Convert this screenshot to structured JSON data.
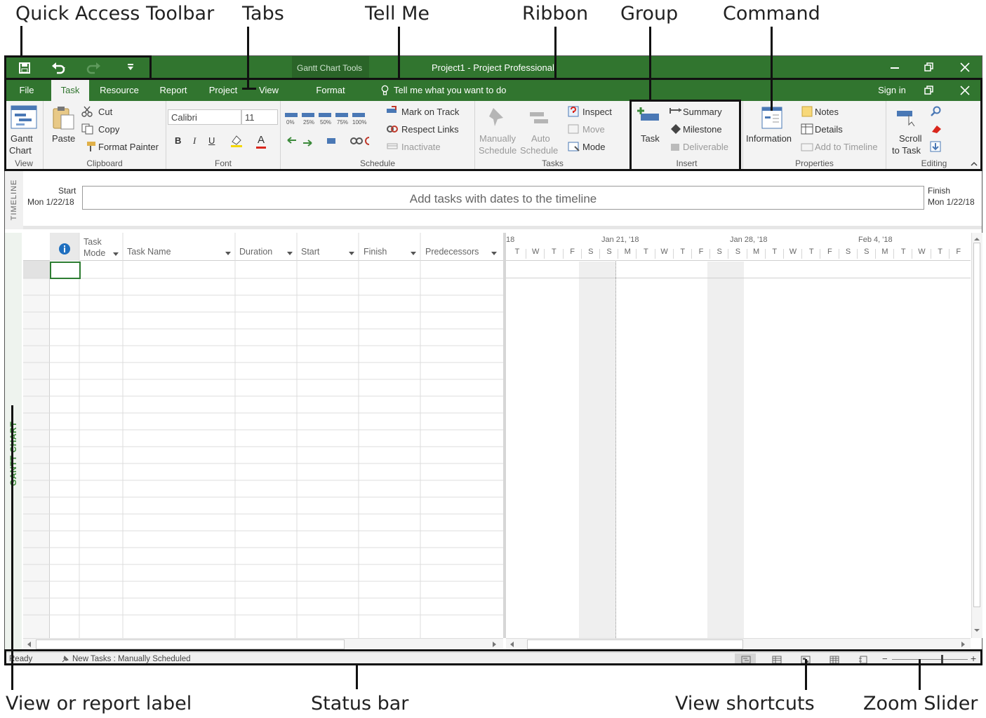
{
  "callouts": {
    "quick_access_toolbar": "Quick Access Toolbar",
    "tabs": "Tabs",
    "tell_me": "Tell Me",
    "ribbon": "Ribbon",
    "group": "Group",
    "command": "Command",
    "view_label": "View or report label",
    "status_bar": "Status bar",
    "view_shortcuts": "View shortcuts",
    "zoom_slider": "Zoom Slider"
  },
  "titlebar": {
    "context_tools": "Gantt Chart Tools",
    "window_title": "Project1 - Project Professional"
  },
  "tabs": [
    "File",
    "Task",
    "Resource",
    "Report",
    "Project",
    "View"
  ],
  "context_tab": "Format",
  "tell_me": "Tell me what you want to do",
  "sign_in": "Sign in",
  "ribbon": {
    "view": {
      "btn_line1": "Gantt",
      "btn_line2": "Chart",
      "label": "View"
    },
    "clipboard": {
      "paste": "Paste",
      "cut": "Cut",
      "copy": "Copy",
      "format_painter": "Format Painter",
      "label": "Clipboard"
    },
    "font": {
      "font_name": "Calibri",
      "font_size": "11",
      "bold": "B",
      "italic": "I",
      "underline": "U",
      "color": "A",
      "label": "Font"
    },
    "schedule": {
      "pcts": [
        "0%",
        "25%",
        "50%",
        "75%",
        "100%"
      ],
      "mark_on_track": "Mark on Track",
      "respect_links": "Respect Links",
      "inactivate": "Inactivate",
      "label": "Schedule"
    },
    "tasks": {
      "manually_1": "Manually",
      "manually_2": "Schedule",
      "auto_1": "Auto",
      "auto_2": "Schedule",
      "inspect": "Inspect",
      "move": "Move",
      "mode": "Mode",
      "label": "Tasks"
    },
    "insert": {
      "task": "Task",
      "summary": "Summary",
      "milestone": "Milestone",
      "deliverable": "Deliverable",
      "label": "Insert"
    },
    "properties": {
      "information": "Information",
      "notes": "Notes",
      "details": "Details",
      "add_to_timeline": "Add to Timeline",
      "label": "Properties"
    },
    "editing": {
      "scroll_1": "Scroll",
      "scroll_2": "to Task",
      "label": "Editing"
    }
  },
  "timeline": {
    "side_label": "TIMELINE",
    "start_label": "Start",
    "start_date": "Mon 1/22/18",
    "placeholder": "Add tasks with dates to the timeline",
    "finish_label": "Finish",
    "finish_date": "Mon 1/22/18"
  },
  "grid": {
    "side_label": "GANTT CHART",
    "columns": [
      "Task Mode",
      "Task Name",
      "Duration",
      "Start",
      "Finish",
      "Predecessors"
    ],
    "task_mode_1": "Task",
    "task_mode_2": "Mode",
    "info_icon": "i"
  },
  "gantt": {
    "weeks": [
      "18",
      "Jan 21, '18",
      "Jan 28, '18",
      "Feb 4, '18"
    ],
    "days": [
      "T",
      "W",
      "T",
      "F",
      "S",
      "S",
      "M",
      "T",
      "W",
      "T",
      "F",
      "S",
      "S",
      "M",
      "T",
      "W",
      "T",
      "F",
      "S",
      "S",
      "M",
      "T",
      "W",
      "T",
      "F"
    ]
  },
  "status": {
    "ready": "Ready",
    "new_tasks": "New Tasks : Manually Scheduled"
  },
  "colors": {
    "accent": "#31752f",
    "ribbon_bg": "#f3f3f3"
  }
}
